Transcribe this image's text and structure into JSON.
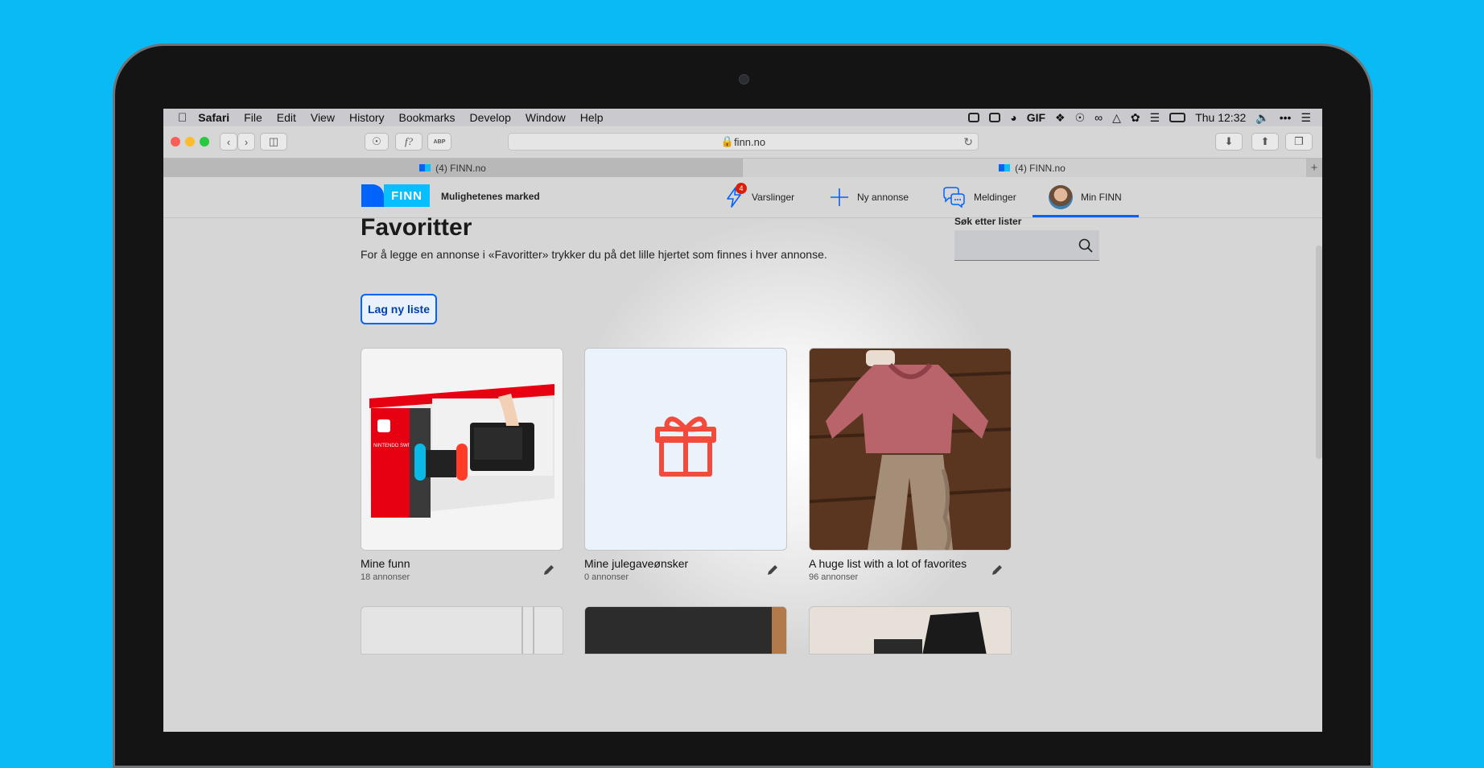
{
  "menubar": {
    "app": "Safari",
    "items": [
      "File",
      "Edit",
      "View",
      "History",
      "Bookmarks",
      "Develop",
      "Window",
      "Help"
    ],
    "gif_label": "GIF",
    "clock": "Thu 12:32"
  },
  "toolbar": {
    "url": "finn.no",
    "reader_label": "f?",
    "abp_label": "ABP"
  },
  "tabs": [
    {
      "label": "(4) FINN.no",
      "active": false
    },
    {
      "label": "(4) FINN.no",
      "active": true
    }
  ],
  "header": {
    "logo_text": "FINN",
    "slogan": "Mulighetenes marked",
    "nav": {
      "alerts_label": "Varslinger",
      "alerts_count": "4",
      "new_ad_label": "Ny annonse",
      "messages_label": "Meldinger",
      "my_finn_label": "Min FINN"
    }
  },
  "main": {
    "title": "Favoritter",
    "intro": "For å legge en annonse i «Favoritter» trykker du på det lille hjertet som finnes i hver annonse.",
    "search_label": "Søk etter lister",
    "search_value": "",
    "new_list_label": "Lag ny liste",
    "lists": [
      {
        "title": "Mine funn",
        "count": "18 annonser",
        "thumb": "nintendo-switch-box"
      },
      {
        "title": "Mine julegaveønsker",
        "count": "0 annonser",
        "thumb": "gift-icon"
      },
      {
        "title": "A huge list with a lot of favorites",
        "count": "96 annonser",
        "thumb": "baby-clothes-photo"
      }
    ],
    "switch_box_text": "NINTENDO SWITCH"
  },
  "colors": {
    "background": "#0abaf5",
    "finn_blue": "#0063fb",
    "finn_cyan": "#06bffc",
    "gift_red": "#f24a3b",
    "badge_red": "#d91f0a"
  }
}
